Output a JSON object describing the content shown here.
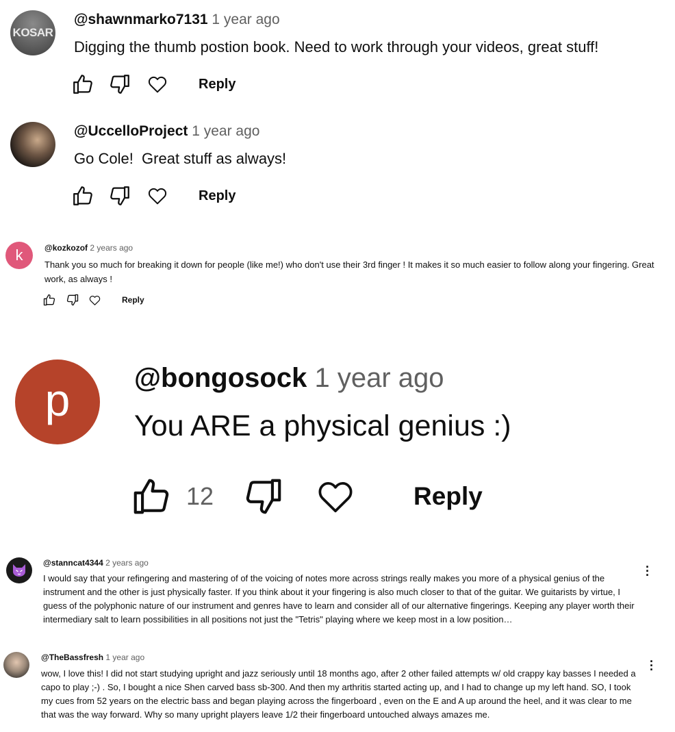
{
  "colors": {
    "text": "#0f0f0f",
    "secondary": "#606060",
    "avatar_k": "#e0587a",
    "avatar_p": "#b6432a",
    "avatar_cat": "#1a1a1a"
  },
  "comments": [
    {
      "author": "@shawnmarko7131",
      "time": "1 year ago",
      "text": "Digging the thumb postion book. Need to work through your videos, great stuff!",
      "avatar_text": "KOSAR",
      "reply": "Reply"
    },
    {
      "author": "@UccelloProject",
      "time": "1 year ago",
      "text": "Go Cole!  Great stuff as always!",
      "reply": "Reply"
    },
    {
      "author": "@kozkozof",
      "time": "2 years ago",
      "text": "Thank you so much for breaking it down for people (like me!) who don't use their 3rd finger ! It makes it so much easier to follow along your fingering. Great work, as always !",
      "avatar_letter": "k",
      "reply": "Reply"
    },
    {
      "author": "@bongosock",
      "time": "1 year ago",
      "text": "You ARE a physical genius :)",
      "avatar_letter": "p",
      "likes": "12",
      "reply": "Reply"
    },
    {
      "author": "@stanncat4344",
      "time": "2 years ago",
      "text": "I would say that your refingering and mastering of of the voicing of notes more across strings really makes you more of a physical genius of the instrument and the other is just physically faster. If you think about it your fingering is also much closer to that of the guitar. We guitarists by virtue, I guess of the polyphonic nature of our instrument and genres have to learn and consider all of our alternative fingerings. Keeping any player worth their intermediary salt to learn possibilities in all positions not just the \"Tetris\" playing where we keep most in a low position…"
    },
    {
      "author": "@TheBassfresh",
      "time": "1 year ago",
      "text": "wow, I love this! I did not start studying upright and jazz seriously until 18 months ago, after 2 other failed attempts w/ old crappy kay basses I needed a capo to play ;-) . So, I bought a nice Shen carved bass sb-300. And then my arthritis started acting up, and I had to change up my left hand. SO, I took my cues from 52 years on the electric bass and began playing across the fingerboard , even on the E and A up around the heel, and it was clear to me that was the way forward. Why so many upright players leave 1/2 their fingerboard untouched always amazes me."
    }
  ]
}
